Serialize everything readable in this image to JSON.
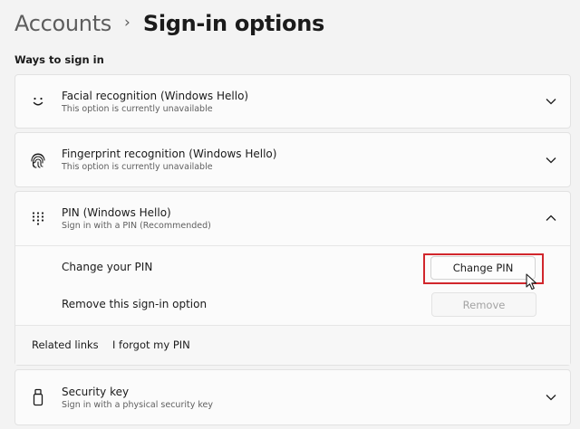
{
  "breadcrumb": {
    "parent": "Accounts",
    "separator": "›",
    "current": "Sign-in options"
  },
  "section": {
    "label": "Ways to sign in"
  },
  "options": {
    "facial": {
      "title": "Facial recognition (Windows Hello)",
      "subtitle": "This option is currently unavailable",
      "icon": "face-icon",
      "expanded": false
    },
    "fingerprint": {
      "title": "Fingerprint recognition (Windows Hello)",
      "subtitle": "This option is currently unavailable",
      "icon": "fingerprint-icon",
      "expanded": false
    },
    "pin": {
      "title": "PIN (Windows Hello)",
      "subtitle": "Sign in with a PIN (Recommended)",
      "icon": "keypad-icon",
      "expanded": true,
      "change_label": "Change your PIN",
      "change_button": "Change PIN",
      "remove_label": "Remove this sign-in option",
      "remove_button": "Remove",
      "related_label": "Related links",
      "related_link": "I forgot my PIN"
    },
    "security_key": {
      "title": "Security key",
      "subtitle": "Sign in with a physical security key",
      "icon": "usb-key-icon",
      "expanded": false
    }
  },
  "colors": {
    "highlight": "#d1262c",
    "background": "#f3f3f3",
    "card": "#fbfbfb"
  }
}
